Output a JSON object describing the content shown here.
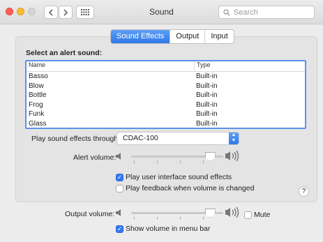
{
  "window": {
    "title": "Sound"
  },
  "search": {
    "placeholder": "Search"
  },
  "tabs": [
    {
      "label": "Sound Effects",
      "active": true
    },
    {
      "label": "Output",
      "active": false
    },
    {
      "label": "Input",
      "active": false
    }
  ],
  "alerts": {
    "section_label": "Select an alert sound:",
    "columns": [
      "Name",
      "Type"
    ],
    "rows": [
      [
        "Basso",
        "Built-in"
      ],
      [
        "Blow",
        "Built-in"
      ],
      [
        "Bottle",
        "Built-in"
      ],
      [
        "Frog",
        "Built-in"
      ],
      [
        "Funk",
        "Built-in"
      ],
      [
        "Glass",
        "Built-in"
      ]
    ]
  },
  "play_through": {
    "label": "Play sound effects through:",
    "value": "CDAC-100"
  },
  "alert_volume": {
    "label": "Alert volume:",
    "level": 0.85
  },
  "options": {
    "ui_sounds": {
      "label": "Play user interface sound effects",
      "checked": true
    },
    "feedback": {
      "label": "Play feedback when volume is changed",
      "checked": false
    }
  },
  "help": {
    "label": "?"
  },
  "output_volume": {
    "label": "Output volume:",
    "level": 0.85
  },
  "mute": {
    "label": "Mute",
    "checked": false
  },
  "menu_bar": {
    "label": "Show volume in menu bar",
    "checked": true
  },
  "colors": {
    "accent": "#3478f6"
  }
}
